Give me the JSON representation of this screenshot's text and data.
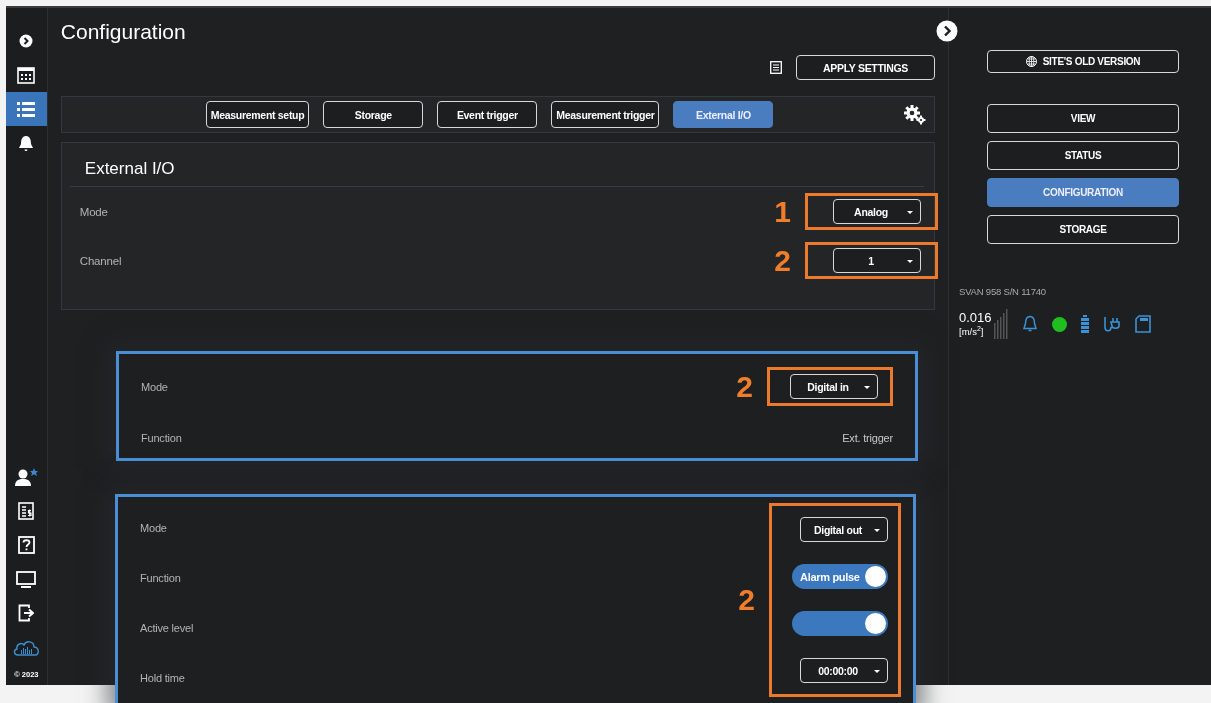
{
  "sidebar": {
    "items": [
      {
        "kind": "expand",
        "selected": false
      },
      {
        "kind": "calendar",
        "selected": false
      },
      {
        "kind": "list",
        "selected": true
      },
      {
        "kind": "bell",
        "selected": false
      }
    ],
    "bottom_items": [
      {
        "kind": "user"
      },
      {
        "kind": "billing"
      },
      {
        "kind": "help"
      },
      {
        "kind": "monitor"
      },
      {
        "kind": "exit"
      },
      {
        "kind": "cloud"
      }
    ],
    "copyright": "© 2023"
  },
  "header": {
    "title": "Configuration",
    "apply_button": "APPLY SETTINGS"
  },
  "tabs": [
    {
      "label": "Measurement setup",
      "selected": false
    },
    {
      "label": "Storage",
      "selected": false
    },
    {
      "label": "Event trigger",
      "selected": false
    },
    {
      "label": "Measurement trigger",
      "selected": false
    },
    {
      "label": "External I/O",
      "selected": true
    }
  ],
  "section": {
    "title": "External I/O",
    "rows": [
      {
        "kind": "dropdown",
        "label": "Mode",
        "value": "Analog",
        "callout": "1"
      },
      {
        "kind": "dropdown",
        "label": "Channel",
        "value": "1",
        "callout": "2"
      }
    ]
  },
  "right_panel": {
    "site_button": "SITE'S OLD VERSION",
    "nav": [
      {
        "label": "VIEW",
        "selected": false
      },
      {
        "label": "STATUS",
        "selected": false
      },
      {
        "label": "CONFIGURATION",
        "selected": true
      },
      {
        "label": "STORAGE",
        "selected": false
      }
    ],
    "device": "SVAN 958 S/N 11740",
    "reading": "0.016",
    "unit": "[m/s$^{2}$]"
  },
  "overlay_panels": [
    {
      "rows": [
        {
          "kind": "dropdown",
          "label": "Mode",
          "value": "Digital in",
          "callout": "2"
        },
        {
          "kind": "text",
          "label": "Function",
          "value": "Ext. trigger"
        }
      ]
    },
    {
      "callout": "2",
      "rows": [
        {
          "kind": "dropdown",
          "label": "Mode",
          "value": "Digital out"
        },
        {
          "kind": "toggle",
          "label": "Function",
          "value": "Alarm pulse",
          "on": true
        },
        {
          "kind": "toggle",
          "label": "Active level",
          "on": true
        },
        {
          "kind": "dropdown",
          "label": "Hold time",
          "value": "00:00:00"
        }
      ]
    }
  ]
}
